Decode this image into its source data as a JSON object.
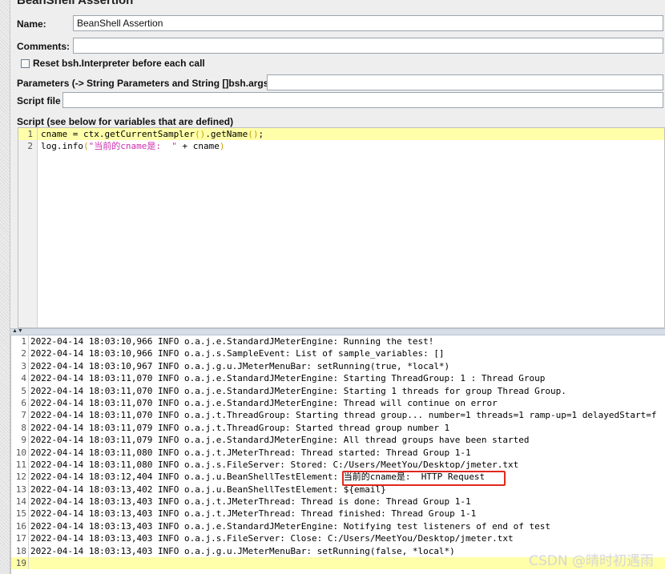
{
  "panel": {
    "title": "BeanShell Assertion",
    "name_label": "Name:",
    "name_value": "BeanShell Assertion",
    "comments_label": "Comments:",
    "comments_value": "",
    "reset_label": "Reset bsh.Interpreter before each call",
    "reset_checked": false,
    "params_label": "Parameters (-> String Parameters and String []bsh.args)",
    "params_value": "",
    "script_file_label": "Script file",
    "script_file_value": "",
    "script_label": "Script (see below for variables that are defined)"
  },
  "script": {
    "lines": [
      {
        "num": "1",
        "parts": [
          {
            "t": "cname = ctx.getCurrentSampler",
            "c": "plain"
          },
          {
            "t": "()",
            "c": "paren"
          },
          {
            "t": ".getName",
            "c": "plain"
          },
          {
            "t": "()",
            "c": "paren"
          },
          {
            "t": ";",
            "c": "plain"
          }
        ]
      },
      {
        "num": "2",
        "parts": [
          {
            "t": "log.info",
            "c": "plain"
          },
          {
            "t": "(",
            "c": "paren"
          },
          {
            "t": "\"当前的cname是:  \"",
            "c": "str"
          },
          {
            "t": " + cname",
            "c": "plain"
          },
          {
            "t": ")",
            "c": "paren"
          }
        ]
      }
    ]
  },
  "log": {
    "lines": [
      {
        "num": "1",
        "text": "2022-04-14 18:03:10,966 INFO o.a.j.e.StandardJMeterEngine: Running the test!"
      },
      {
        "num": "2",
        "text": "2022-04-14 18:03:10,966 INFO o.a.j.s.SampleEvent: List of sample_variables: []"
      },
      {
        "num": "3",
        "text": "2022-04-14 18:03:10,967 INFO o.a.j.g.u.JMeterMenuBar: setRunning(true, *local*)"
      },
      {
        "num": "4",
        "text": "2022-04-14 18:03:11,070 INFO o.a.j.e.StandardJMeterEngine: Starting ThreadGroup: 1 : Thread Group"
      },
      {
        "num": "5",
        "text": "2022-04-14 18:03:11,070 INFO o.a.j.e.StandardJMeterEngine: Starting 1 threads for group Thread Group."
      },
      {
        "num": "6",
        "text": "2022-04-14 18:03:11,070 INFO o.a.j.e.StandardJMeterEngine: Thread will continue on error"
      },
      {
        "num": "7",
        "text": "2022-04-14 18:03:11,070 INFO o.a.j.t.ThreadGroup: Starting thread group... number=1 threads=1 ramp-up=1 delayedStart=f"
      },
      {
        "num": "8",
        "text": "2022-04-14 18:03:11,079 INFO o.a.j.t.ThreadGroup: Started thread group number 1"
      },
      {
        "num": "9",
        "text": "2022-04-14 18:03:11,079 INFO o.a.j.e.StandardJMeterEngine: All thread groups have been started"
      },
      {
        "num": "10",
        "text": "2022-04-14 18:03:11,080 INFO o.a.j.t.JMeterThread: Thread started: Thread Group 1-1"
      },
      {
        "num": "11",
        "text": "2022-04-14 18:03:11,080 INFO o.a.j.s.FileServer: Stored: C:/Users/MeetYou/Desktop/jmeter.txt"
      },
      {
        "num": "12",
        "text": "2022-04-14 18:03:12,404 INFO o.a.j.u.BeanShellTestElement: 当前的cname是:  HTTP Request"
      },
      {
        "num": "13",
        "text": "2022-04-14 18:03:13,402 INFO o.a.j.u.BeanShellTestElement: ${email}"
      },
      {
        "num": "14",
        "text": "2022-04-14 18:03:13,403 INFO o.a.j.t.JMeterThread: Thread is done: Thread Group 1-1"
      },
      {
        "num": "15",
        "text": "2022-04-14 18:03:13,403 INFO o.a.j.t.JMeterThread: Thread finished: Thread Group 1-1"
      },
      {
        "num": "16",
        "text": "2022-04-14 18:03:13,403 INFO o.a.j.e.StandardJMeterEngine: Notifying test listeners of end of test"
      },
      {
        "num": "17",
        "text": "2022-04-14 18:03:13,403 INFO o.a.j.s.FileServer: Close: C:/Users/MeetYou/Desktop/jmeter.txt"
      },
      {
        "num": "18",
        "text": "2022-04-14 18:03:13,403 INFO o.a.j.g.u.JMeterMenuBar: setRunning(false, *local*)"
      },
      {
        "num": "19",
        "text": ""
      }
    ]
  },
  "watermark": "CSDN @晴时初遇雨",
  "colors": {
    "active_line": "#ffffaa",
    "string": "#cc2fb0",
    "paren": "#c8a000",
    "highlight": "#e0281e"
  }
}
